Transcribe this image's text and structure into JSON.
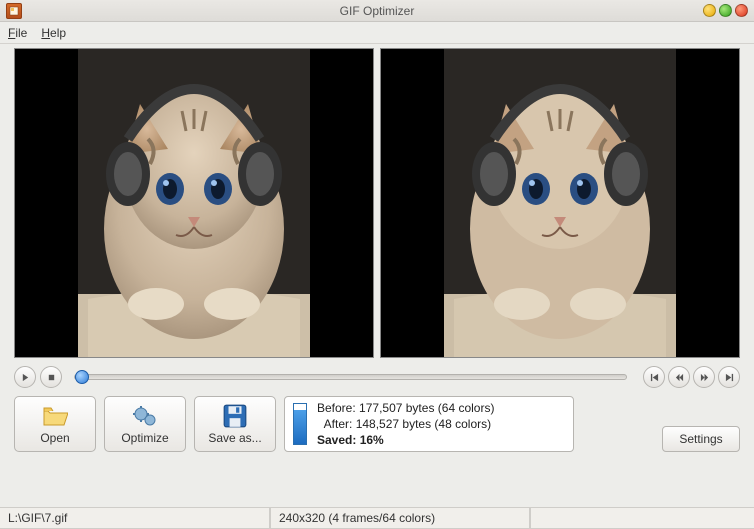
{
  "window": {
    "title": "GIF Optimizer"
  },
  "menu": {
    "file": "File",
    "help": "Help"
  },
  "actions": {
    "open": "Open",
    "optimize": "Optimize",
    "save_as": "Save as...",
    "settings": "Settings"
  },
  "info": {
    "before_label": "Before:",
    "before_value": "177,507 bytes (64 colors)",
    "after_label": "After:",
    "after_value": "148,527 bytes (48 colors)",
    "saved_label": "Saved:",
    "saved_value": "16%"
  },
  "status": {
    "path": "L:\\GIF\\7.gif",
    "dimensions": "240x320 (4 frames/64 colors)"
  }
}
